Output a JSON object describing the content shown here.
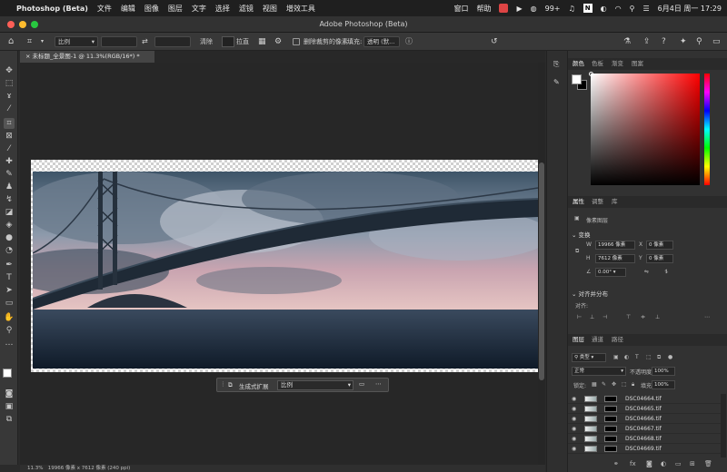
{
  "menubar": {
    "app": "Photoshop (Beta)",
    "items": [
      "文件",
      "编辑",
      "图像",
      "图层",
      "文字",
      "选择",
      "滤镜",
      "视图",
      "增效工具"
    ],
    "right_items": [
      "窗口",
      "帮助"
    ],
    "badge": "99+",
    "clock": "6月4日 周一  17:29"
  },
  "window": {
    "title": "Adobe Photoshop (Beta)",
    "doc_tab": "未标题_全景图-1 @ 11.3%(RGB/16*) *"
  },
  "options": {
    "ratio_select": "比例",
    "clear_button": "清除",
    "straighten_label": "拉直",
    "delete_pixels_label": "删除裁剪的像素",
    "fill_label": "填充:",
    "fill_select": "透明 (默..."
  },
  "context_bar": {
    "generative_expand": "生成式扩展",
    "ratio": "比例"
  },
  "status": {
    "zoom": "11.3%",
    "doc_info": "19966 像素 x 7612 像素 (240 ppi)"
  },
  "color_panel": {
    "tabs": [
      "颜色",
      "色板",
      "渐变",
      "图案"
    ],
    "foreground": "#ffffff",
    "background": "#000000",
    "hue_color": "#ff0000"
  },
  "properties_panel": {
    "tabs": [
      "属性",
      "调整",
      "库"
    ],
    "type_label": "像素图层",
    "transform_title": "变换",
    "w_label": "W",
    "w_value": "19966 像素",
    "h_label": "H",
    "h_value": "7612 像素",
    "x_label": "X",
    "x_value": "0 像素",
    "y_label": "Y",
    "y_value": "0 像素",
    "angle_value": "0.00°",
    "align_title": "对齐并分布",
    "align_label": "对齐:"
  },
  "layers_panel": {
    "tabs": [
      "图层",
      "通道",
      "路径"
    ],
    "filter_select": "类型",
    "blend_mode": "正常",
    "opacity_label": "不透明度:",
    "opacity_value": "100%",
    "lock_label": "锁定:",
    "fill_label": "填充:",
    "fill_value": "100%",
    "layers": [
      "DSC04664.tif",
      "DSC04665.tif",
      "DSC04666.tif",
      "DSC04667.tif",
      "DSC04668.tif",
      "DSC04669.tif"
    ]
  }
}
